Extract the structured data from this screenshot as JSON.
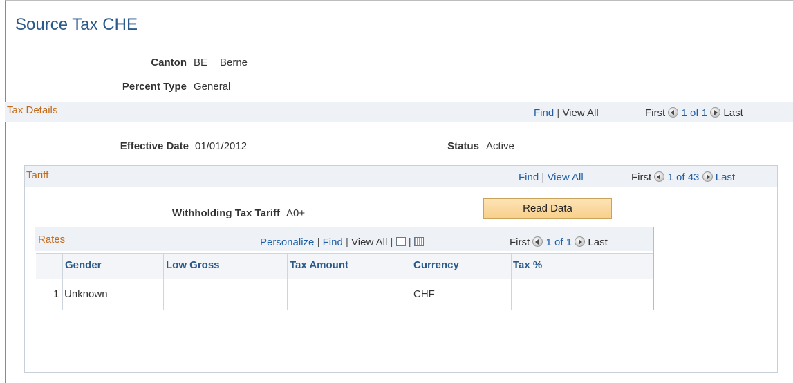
{
  "page": {
    "title": "Source Tax CHE"
  },
  "header": {
    "canton_label": "Canton",
    "canton_code": "BE",
    "canton_name": "Berne",
    "percent_type_label": "Percent Type",
    "percent_type_value": "General"
  },
  "tax_details": {
    "title": "Tax Details",
    "find": "Find",
    "separator": "|",
    "view_all": "View All",
    "first": "First",
    "count": "1 of 1",
    "last": "Last",
    "effective_date_label": "Effective Date",
    "effective_date_value": "01/01/2012",
    "status_label": "Status",
    "status_value": "Active"
  },
  "tariff": {
    "title": "Tariff",
    "find": "Find",
    "separator": "|",
    "view_all": "View All",
    "first": "First",
    "count": "1 of 43",
    "last": "Last",
    "withholding_label": "Withholding Tax Tariff",
    "withholding_value": "A0+",
    "read_data_button": "Read Data"
  },
  "rates": {
    "title": "Rates",
    "personalize": "Personalize",
    "separator": "|",
    "find": "Find",
    "view_all": "View All",
    "first": "First",
    "count": "1 of 1",
    "last": "Last",
    "icons": [
      "new-window-icon",
      "spreadsheet-icon"
    ],
    "columns": [
      "Gender",
      "Low Gross",
      "Tax Amount",
      "Currency",
      "Tax %"
    ],
    "rows": [
      {
        "num": "1",
        "gender": "Unknown",
        "low_gross": "",
        "tax_amount": "",
        "currency": "CHF",
        "tax_pct": ""
      }
    ]
  },
  "colors": {
    "link": "#1f5fa8",
    "section_header": "#c36a1a",
    "title": "#2b5a8a",
    "button": "#f7cf8a"
  }
}
